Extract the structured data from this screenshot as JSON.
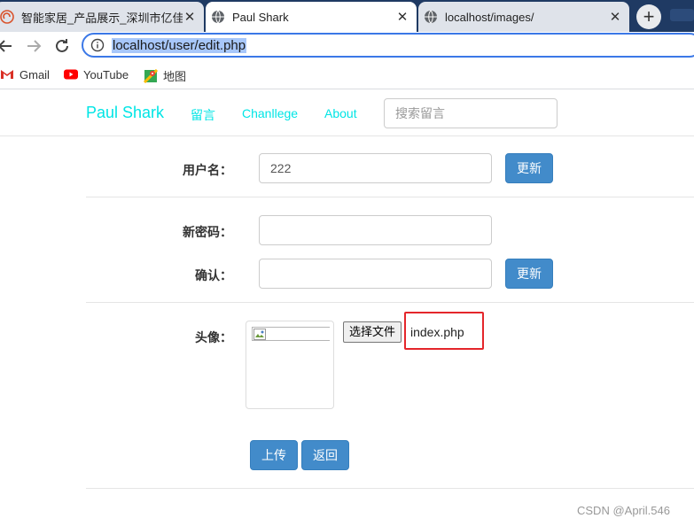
{
  "browser": {
    "tabs": [
      {
        "title": "智能家居_产品展示_深圳市亿佳科",
        "icon": "site-swirl-icon",
        "active": false
      },
      {
        "title": "Paul Shark",
        "icon": "globe-icon",
        "active": true
      },
      {
        "title": "localhost/images/",
        "icon": "globe-icon",
        "active": false
      }
    ],
    "new_tab_symbol": "+",
    "close_symbol": "✕",
    "address": "localhost/user/edit.php",
    "bookmarks": [
      {
        "label": "Gmail",
        "icon": "gmail-icon"
      },
      {
        "label": "YouTube",
        "icon": "youtube-icon"
      },
      {
        "label": "地图",
        "icon": "maps-icon"
      }
    ]
  },
  "site": {
    "brand": "Paul Shark",
    "nav": [
      "留言",
      "Chanllege",
      "About"
    ],
    "search_placeholder": "搜索留言",
    "accent_color": "#00e5e5"
  },
  "form": {
    "username_label": "用户名：",
    "username_value": "222",
    "update_label": "更新",
    "new_password_label": "新密码：",
    "confirm_label": "确认：",
    "avatar_label": "头像：",
    "choose_file_label": "选择文件",
    "chosen_file": "index.php",
    "upload_label": "上传",
    "back_label": "返回",
    "button_color": "#428bca"
  },
  "watermark": "CSDN @April.546"
}
